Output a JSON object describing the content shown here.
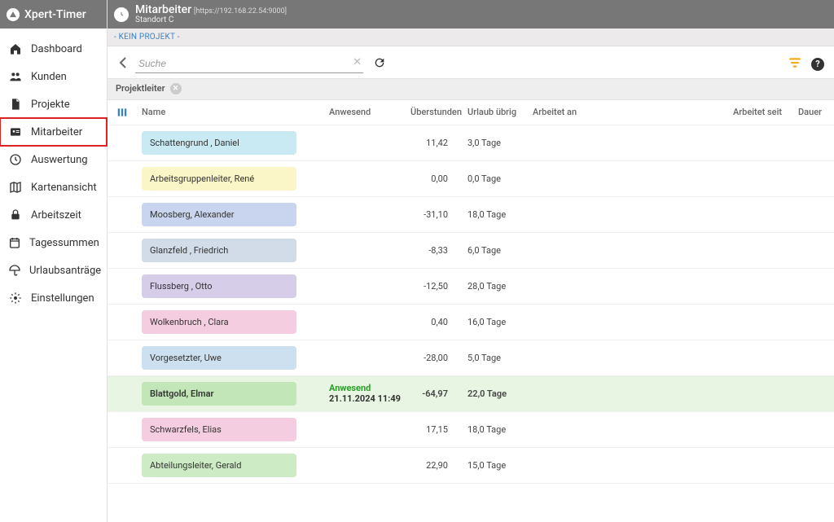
{
  "app": {
    "name": "Xpert-Timer"
  },
  "header": {
    "title": "Mitarbeiter",
    "subtitle": "Standort C",
    "url": "[https://192.168.22.54:9000]"
  },
  "subheader": {
    "noproject": "- KEIN PROJEKT -"
  },
  "search": {
    "placeholder": "Suche",
    "value": ""
  },
  "filterchip": {
    "label": "Projektleiter"
  },
  "nav": [
    {
      "id": "dashboard",
      "label": "Dashboard",
      "icon": "home"
    },
    {
      "id": "kunden",
      "label": "Kunden",
      "icon": "people"
    },
    {
      "id": "projekte",
      "label": "Projekte",
      "icon": "doc"
    },
    {
      "id": "mitarbeiter",
      "label": "Mitarbeiter",
      "icon": "idcard",
      "active": true
    },
    {
      "id": "auswertung",
      "label": "Auswertung",
      "icon": "clock"
    },
    {
      "id": "kartenansicht",
      "label": "Kartenansicht",
      "icon": "map"
    },
    {
      "id": "arbeitszeit",
      "label": "Arbeitszeit",
      "icon": "lock"
    },
    {
      "id": "tagessummen",
      "label": "Tagessummen",
      "icon": "calendar"
    },
    {
      "id": "urlaubsantraege",
      "label": "Urlaubsanträge",
      "icon": "umbrella"
    },
    {
      "id": "einstellungen",
      "label": "Einstellungen",
      "icon": "gear"
    }
  ],
  "columns": {
    "name": "Name",
    "anwesend": "Anwesend",
    "ueberstunden": "Überstunden",
    "urlaub": "Urlaub übrig",
    "arbeitet_an": "Arbeitet an",
    "arbeitet_seit": "Arbeitet seit",
    "dauer": "Dauer"
  },
  "rows": [
    {
      "name": "Schattengrund , Daniel",
      "color": "c-lightblue",
      "anwesend": "",
      "ueber": "11,42",
      "urlaub": "3,0 Tage"
    },
    {
      "name": "Arbeitsgruppenleiter, René",
      "color": "c-yellow",
      "anwesend": "",
      "ueber": "0,00",
      "urlaub": "0,0 Tage"
    },
    {
      "name": "Moosberg, Alexander",
      "color": "c-blue",
      "anwesend": "",
      "ueber": "-31,10",
      "urlaub": "18,0 Tage"
    },
    {
      "name": "Glanzfeld  , Friedrich",
      "color": "c-bluegray",
      "anwesend": "",
      "ueber": "-8,33",
      "urlaub": "6,0 Tage"
    },
    {
      "name": "Flussberg  , Otto",
      "color": "c-purple",
      "anwesend": "",
      "ueber": "-12,50",
      "urlaub": "28,0 Tage"
    },
    {
      "name": "Wolkenbruch  , Clara",
      "color": "c-pink",
      "anwesend": "",
      "ueber": "0,40",
      "urlaub": "16,0 Tage"
    },
    {
      "name": "Vorgesetzter, Uwe",
      "color": "c-bluelt",
      "anwesend": "",
      "ueber": "-28,00",
      "urlaub": "5,0 Tage"
    },
    {
      "name": "Blattgold, Elmar",
      "color": "c-green",
      "anwesend_label": "Anwesend",
      "anwesend_ts": "21.11.2024  11:49",
      "ueber": "-64,97",
      "urlaub": "22,0 Tage",
      "highlight": true
    },
    {
      "name": "Schwarzfels, Elias",
      "color": "c-pink",
      "anwesend": "",
      "ueber": "17,15",
      "urlaub": "18,0 Tage"
    },
    {
      "name": "Abteilungsleiter, Gerald",
      "color": "c-greenlt",
      "anwesend": "",
      "ueber": "22,90",
      "urlaub": "15,0 Tage"
    }
  ]
}
